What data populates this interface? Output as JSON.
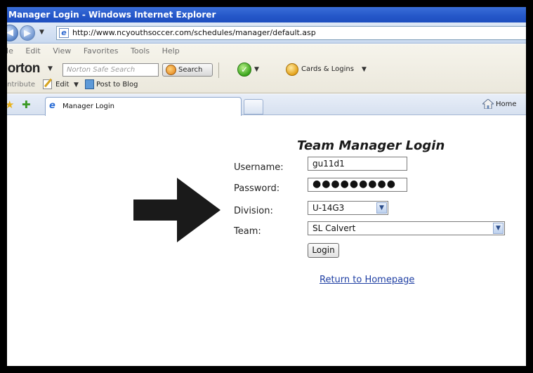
{
  "window": {
    "title": "Manager Login - Windows Internet Explorer",
    "address": "http://www.ncyouthsoccer.com/schedules/manager/default.asp"
  },
  "menubar": {
    "items": [
      "ile",
      "Edit",
      "View",
      "Favorites",
      "Tools",
      "Help"
    ]
  },
  "norton_toolbar": {
    "logo": "lorton",
    "search_placeholder": "Norton Safe Search",
    "search_button": "Search",
    "cards_logins": "Cards & Logins"
  },
  "links_toolbar": {
    "contribute": "ontribute",
    "edit": "Edit",
    "post_to_blog": "Post to Blog"
  },
  "tabs": {
    "active": "Manager Login",
    "home": "Home"
  },
  "page": {
    "heading": "Team Manager Login",
    "username_label": "Username:",
    "username_value": "gu11d1",
    "password_label": "Password:",
    "password_value": "●●●●●●●●●",
    "division_label": "Division:",
    "division_value": "U-14G3",
    "team_label": "Team:",
    "team_value": "SL Calvert",
    "login_button": "Login",
    "return_link": "Return to Homepage"
  },
  "icons": {
    "arrow": "right-arrow-icon",
    "back": "back-icon",
    "forward": "forward-icon"
  }
}
